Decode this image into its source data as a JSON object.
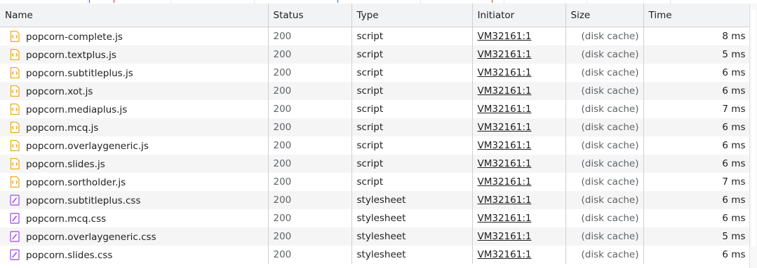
{
  "table": {
    "columns": {
      "name": "Name",
      "status": "Status",
      "type": "Type",
      "initiator": "Initiator",
      "size": "Size",
      "time": "Time"
    },
    "rows": [
      {
        "name": "popcorn-complete.js",
        "status": "200",
        "type": "script",
        "initiator": "VM32161:1",
        "size": "(disk cache)",
        "time": "8 ms",
        "icon": "js-file-icon"
      },
      {
        "name": "popcorn.textplus.js",
        "status": "200",
        "type": "script",
        "initiator": "VM32161:1",
        "size": "(disk cache)",
        "time": "5 ms",
        "icon": "js-file-icon"
      },
      {
        "name": "popcorn.subtitleplus.js",
        "status": "200",
        "type": "script",
        "initiator": "VM32161:1",
        "size": "(disk cache)",
        "time": "6 ms",
        "icon": "js-file-icon"
      },
      {
        "name": "popcorn.xot.js",
        "status": "200",
        "type": "script",
        "initiator": "VM32161:1",
        "size": "(disk cache)",
        "time": "6 ms",
        "icon": "js-file-icon"
      },
      {
        "name": "popcorn.mediaplus.js",
        "status": "200",
        "type": "script",
        "initiator": "VM32161:1",
        "size": "(disk cache)",
        "time": "7 ms",
        "icon": "js-file-icon"
      },
      {
        "name": "popcorn.mcq.js",
        "status": "200",
        "type": "script",
        "initiator": "VM32161:1",
        "size": "(disk cache)",
        "time": "6 ms",
        "icon": "js-file-icon"
      },
      {
        "name": "popcorn.overlaygeneric.js",
        "status": "200",
        "type": "script",
        "initiator": "VM32161:1",
        "size": "(disk cache)",
        "time": "6 ms",
        "icon": "js-file-icon"
      },
      {
        "name": "popcorn.slides.js",
        "status": "200",
        "type": "script",
        "initiator": "VM32161:1",
        "size": "(disk cache)",
        "time": "6 ms",
        "icon": "js-file-icon"
      },
      {
        "name": "popcorn.sortholder.js",
        "status": "200",
        "type": "script",
        "initiator": "VM32161:1",
        "size": "(disk cache)",
        "time": "7 ms",
        "icon": "js-file-icon"
      },
      {
        "name": "popcorn.subtitleplus.css",
        "status": "200",
        "type": "stylesheet",
        "initiator": "VM32161:1",
        "size": "(disk cache)",
        "time": "6 ms",
        "icon": "css-file-icon"
      },
      {
        "name": "popcorn.mcq.css",
        "status": "200",
        "type": "stylesheet",
        "initiator": "VM32161:1",
        "size": "(disk cache)",
        "time": "6 ms",
        "icon": "css-file-icon"
      },
      {
        "name": "popcorn.overlaygeneric.css",
        "status": "200",
        "type": "stylesheet",
        "initiator": "VM32161:1",
        "size": "(disk cache)",
        "time": "5 ms",
        "icon": "css-file-icon"
      },
      {
        "name": "popcorn.slides.css",
        "status": "200",
        "type": "stylesheet",
        "initiator": "VM32161:1",
        "size": "(disk cache)",
        "time": "6 ms",
        "icon": "css-file-icon"
      }
    ]
  },
  "colors": {
    "js_icon": "#f2a600",
    "css_icon": "#a142f4",
    "header_bg": "#f1f3f4",
    "stripe_bg": "#f5f5f5"
  }
}
